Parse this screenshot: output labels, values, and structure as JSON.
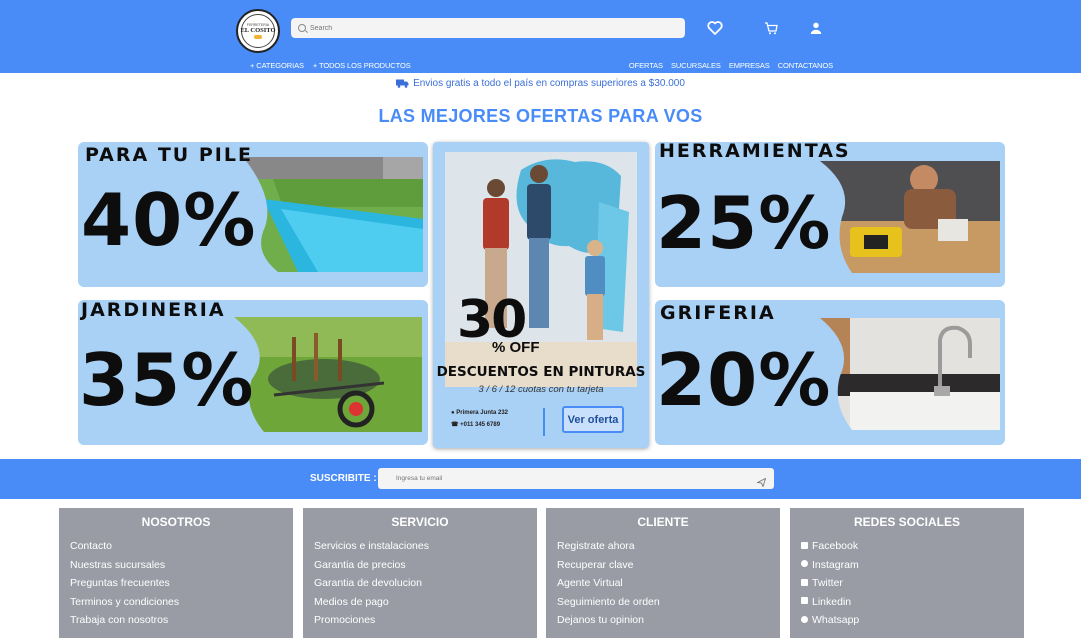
{
  "header": {
    "logo_text": "EL COSITO",
    "logo_sub": "FERRETERIA",
    "search_placeholder": "Search",
    "nav_left": [
      "+ CATEGORIAS",
      "+ TODOS LOS PRODUCTOS"
    ],
    "nav_right": [
      "OFERTAS",
      "SUCURSALES",
      "EMPRESAS",
      "CONTACTANOS"
    ]
  },
  "shipping_banner": "Envios gratis a todo el país en compras superiores a $30.000",
  "section_title": "LAS MEJORES OFERTAS PARA VOS",
  "promos": {
    "pile": {
      "title": "PARA TU PILE",
      "percent": "40%"
    },
    "herramientas": {
      "title": "HERRAMIENTAS",
      "percent": "25%"
    },
    "jardineria": {
      "title": "JARDINERIA",
      "percent": "35%"
    },
    "griferia": {
      "title": "GRIFERIA",
      "percent": "20%"
    },
    "pinturas": {
      "discount": "30",
      "off": "% OFF",
      "headline": "DESCUENTOS EN PINTURAS",
      "cuotas": "3 / 6 / 12 cuotas con tu tarjeta",
      "address": "Primera Junta 232",
      "phone": "+011 345 6789",
      "cta": "Ver oferta"
    }
  },
  "subscribe": {
    "label": "SUSCRIBITE :",
    "placeholder": "Ingresa tu email"
  },
  "footer": {
    "nosotros": {
      "title": "NOSOTROS",
      "links": [
        "Contacto",
        "Nuestras sucursales",
        "Preguntas frecuentes",
        "Terminos y condiciones",
        "Trabaja con nosotros"
      ]
    },
    "servicio": {
      "title": "SERVICIO",
      "links": [
        "Servicios e instalaciones",
        "Garantia de precios",
        "Garantia de devolucion",
        "Medios de pago",
        "Promociones"
      ]
    },
    "cliente": {
      "title": "CLIENTE",
      "links": [
        "Registrate ahora",
        "Recuperar clave",
        "Agente Virtual",
        "Seguimiento de orden",
        "Dejanos tu opinion"
      ]
    },
    "redes": {
      "title": "REDES SOCIALES",
      "links": [
        "Facebook",
        "Instagram",
        "Twitter",
        "Linkedin",
        "Whatsapp"
      ]
    }
  },
  "colors": {
    "brand_blue": "#4a8cf7",
    "card_blue": "#a9d0f5",
    "footer_gray": "#9a9ca5"
  }
}
